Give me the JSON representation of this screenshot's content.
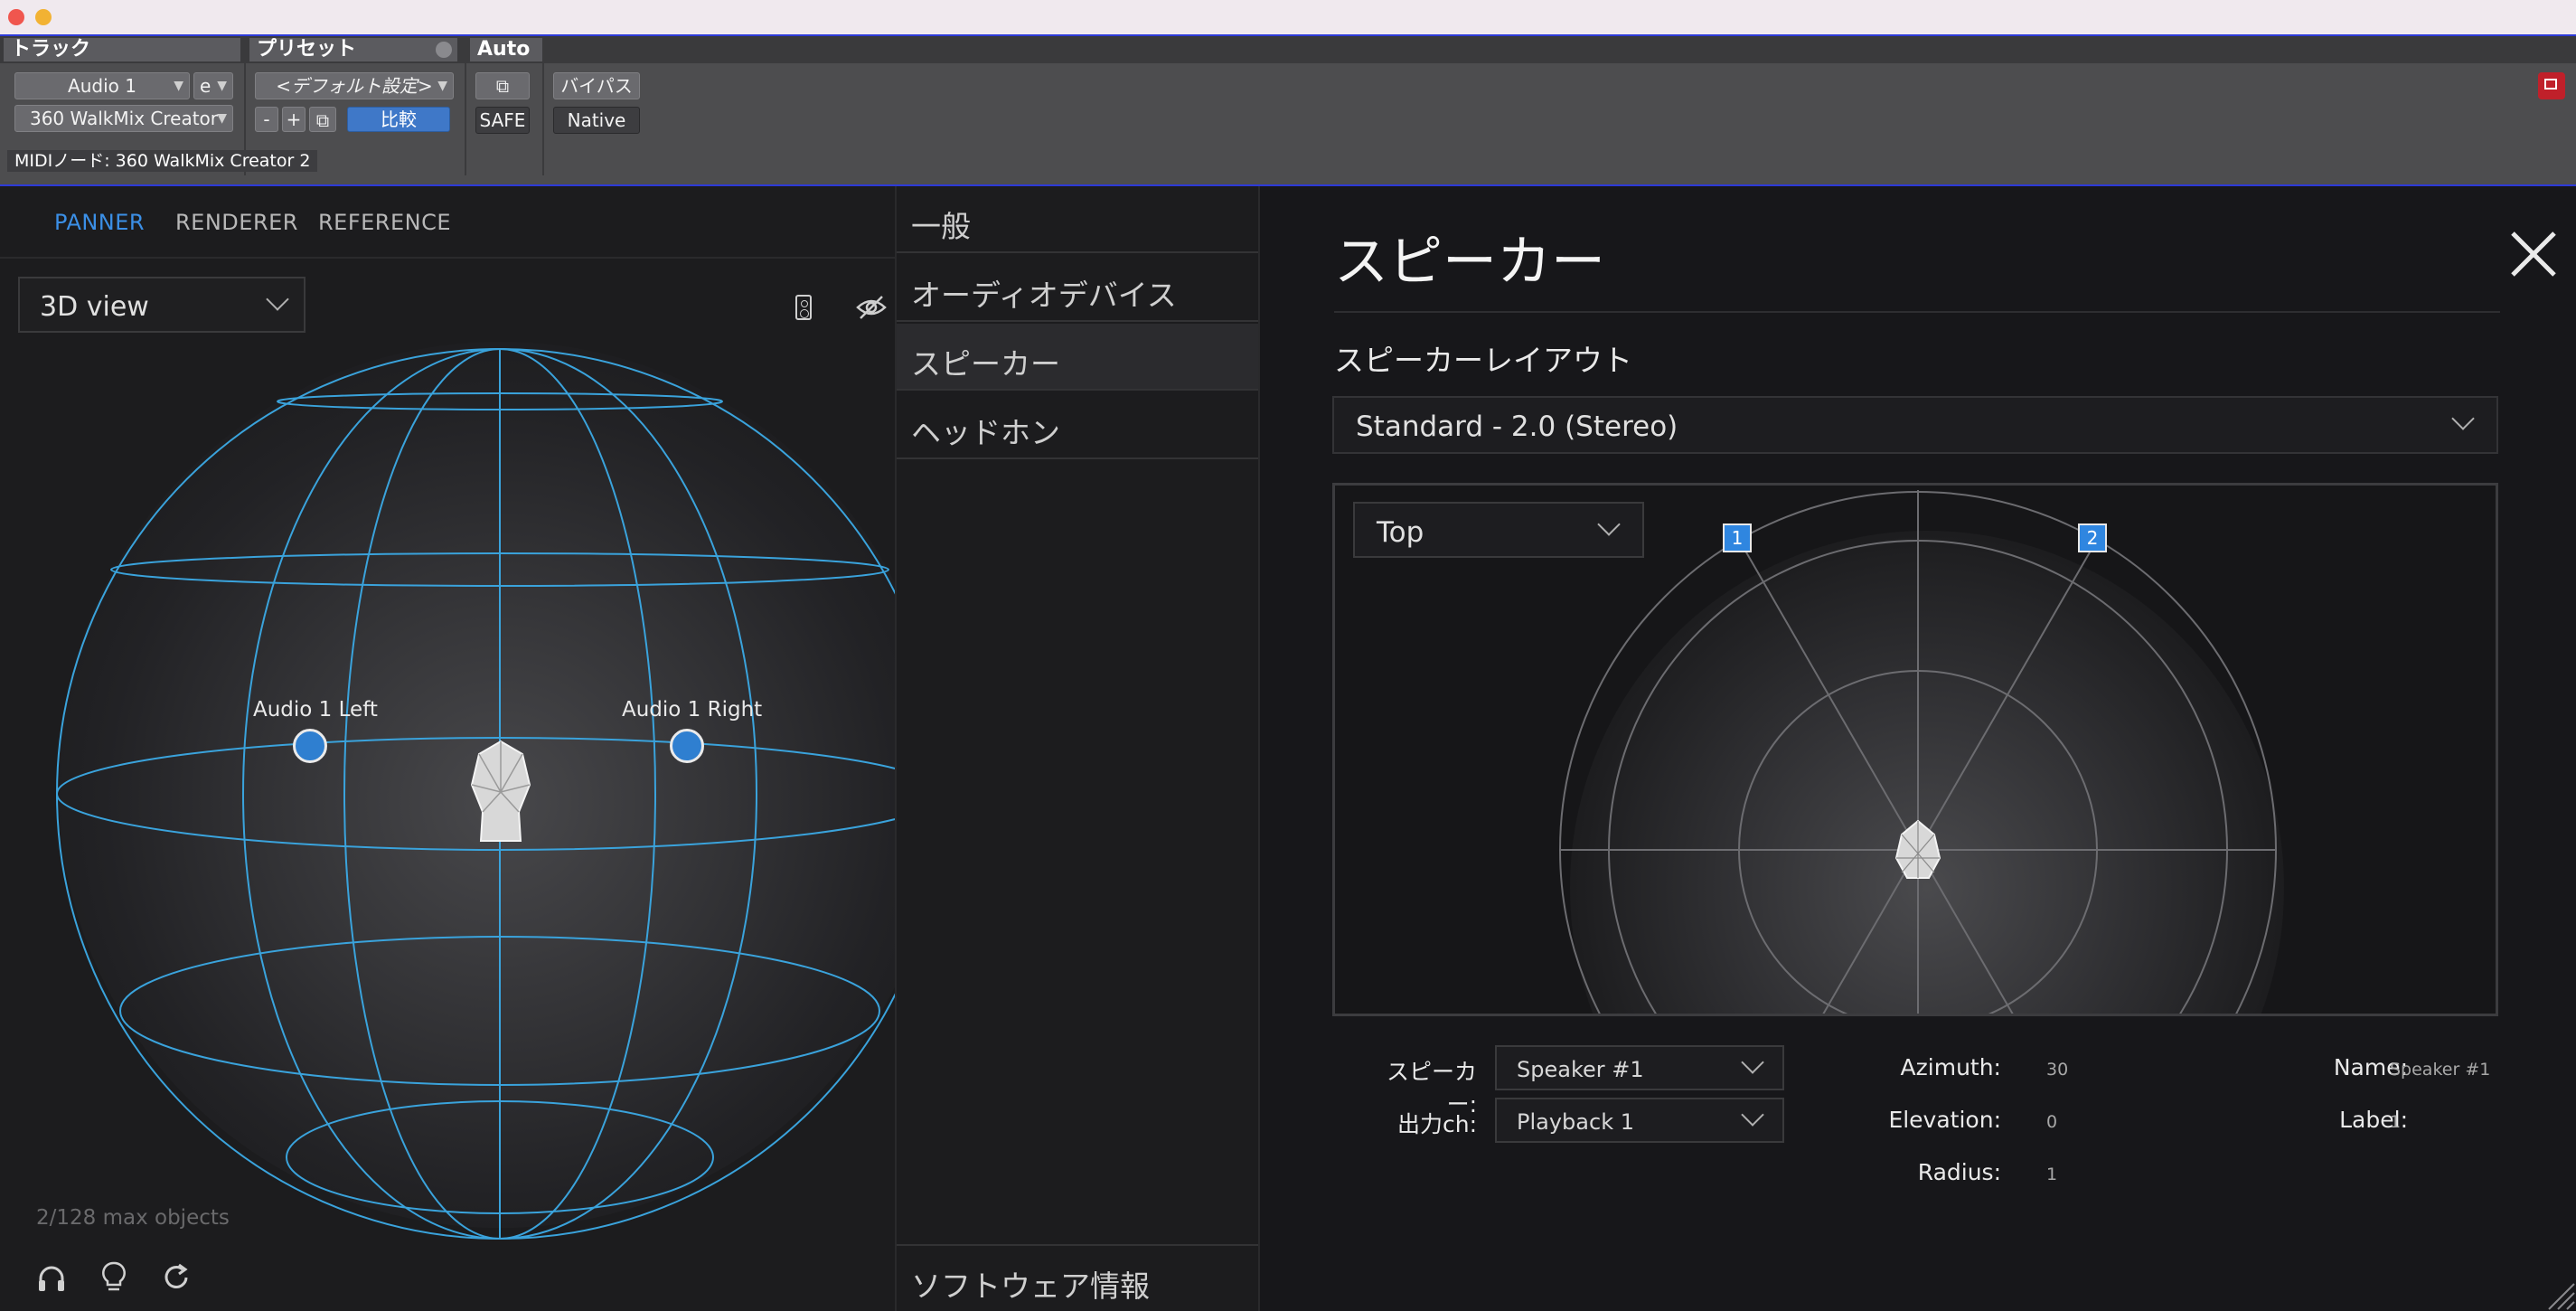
{
  "header": {
    "track_label": "トラック",
    "preset_label": "プリセット",
    "auto_label": "Auto",
    "track_name": "Audio 1",
    "track_e": "e",
    "plugin_name": "360 WalkMix Creator",
    "preset_value": "<デフォルト設定>",
    "minus": "-",
    "plus": "+",
    "compare": "比較",
    "bypass": "バイパス",
    "safe": "SAFE",
    "native": "Native",
    "midi_node": "MIDIノード: 360 WalkMix Creator 2"
  },
  "left": {
    "tabs": [
      "PANNER",
      "RENDERER",
      "REFERENCE"
    ],
    "view_select": "3D view",
    "objects": [
      "Audio 1 Left",
      "Audio 1 Right"
    ],
    "max_objects": "2/128 max objects",
    "bottom_icons": [
      "headphones-icon",
      "lightbulb-icon",
      "refresh-icon"
    ]
  },
  "nav": {
    "items": [
      "一般",
      "オーディオデバイス",
      "スピーカー",
      "ヘッドホン"
    ],
    "bottom": "ソフトウェア情報"
  },
  "settings": {
    "title": "スピーカー",
    "layout_label": "スピーカーレイアウト",
    "layout_value": "Standard - 2.0 (Stereo)",
    "view_value": "Top",
    "speakers": [
      "1",
      "2"
    ],
    "speaker_label": "スピーカー:",
    "speaker_value": "Speaker #1",
    "output_label": "出力ch:",
    "output_value": "Playback 1",
    "azimuth_label": "Azimuth:",
    "azimuth_value": "30",
    "elevation_label": "Elevation:",
    "elevation_value": "0",
    "radius_label": "Radius:",
    "radius_value": "1",
    "name_label": "Name:",
    "name_value": "Speaker #1",
    "label_label": "Label:",
    "label_value": "1"
  },
  "colors": {
    "accent": "#3b8fe6",
    "wireframe": "#3aa3dc",
    "speaker_marker": "#2f86e0"
  }
}
